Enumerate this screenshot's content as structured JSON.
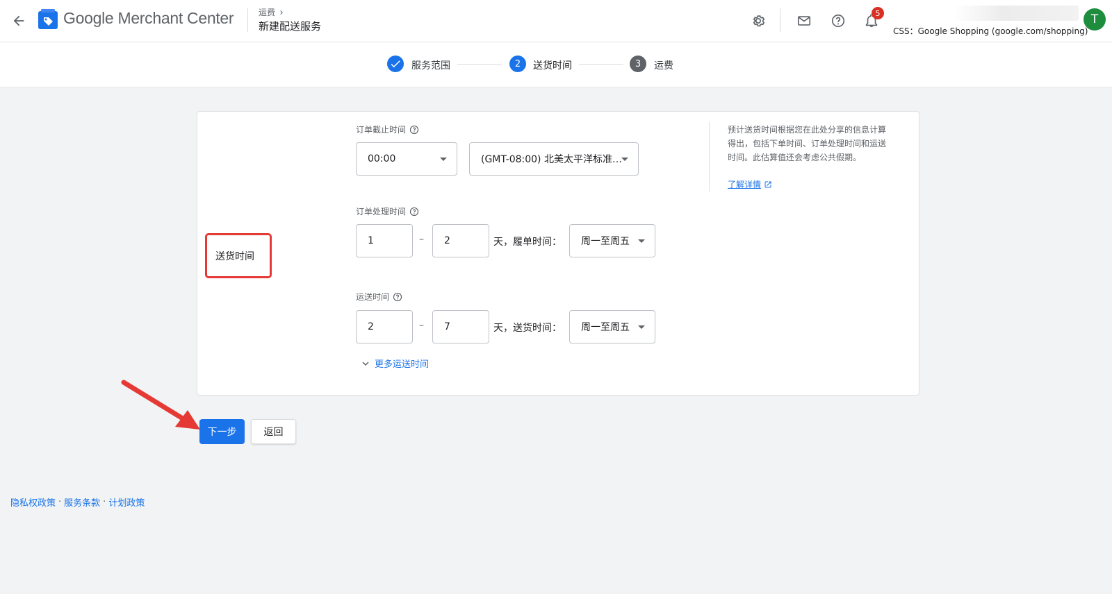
{
  "header": {
    "app_name": "Google Merchant Center",
    "breadcrumb": "运费",
    "page_title": "新建配送服务",
    "notification_count": "5",
    "account_line": "CSS：Google Shopping (google.com/shopping)",
    "avatar_initial": "T"
  },
  "stepper": {
    "steps": [
      {
        "label": "服务范围",
        "state": "done"
      },
      {
        "label": "送货时间",
        "number": "2",
        "state": "active"
      },
      {
        "label": "运费",
        "number": "3",
        "state": "pending"
      }
    ]
  },
  "form": {
    "section_label": "送货时间",
    "cutoff": {
      "label": "订单截止时间",
      "time_value": "00:00",
      "timezone_value": "(GMT-08:00) 北美太平洋标准…"
    },
    "handling": {
      "label": "订单处理时间",
      "min": "1",
      "max": "2",
      "suffix": "天，履单时间：",
      "days_value": "周一至周五"
    },
    "transit": {
      "label": "运送时间",
      "min": "2",
      "max": "7",
      "suffix": "天，送货时间：",
      "days_value": "周一至周五"
    },
    "more_link": "更多运送时间",
    "dash": "–"
  },
  "info": {
    "text": "预计送货时间根据您在此处分享的信息计算得出，包括下单时间、订单处理时间和运送时间。此估算值还会考虑公共假期。",
    "link": "了解详情"
  },
  "buttons": {
    "next": "下一步",
    "back": "返回"
  },
  "footer": {
    "links": [
      "隐私权政策",
      "服务条款",
      "计划政策"
    ],
    "separator": "·"
  },
  "colors": {
    "primary": "#1a73e8",
    "annotation": "#e53935",
    "badge": "#d93025",
    "avatar": "#1e8e3e"
  }
}
